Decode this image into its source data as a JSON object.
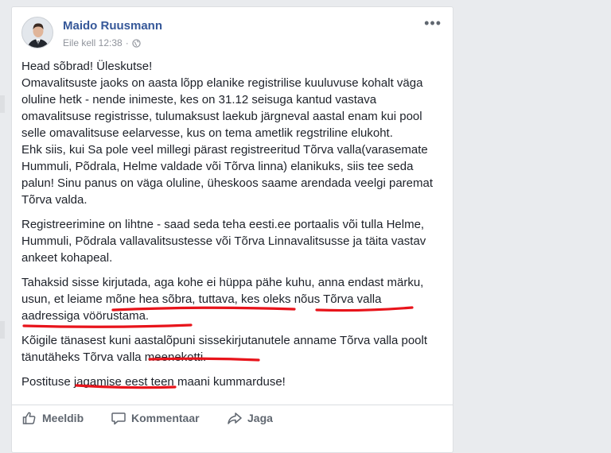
{
  "post": {
    "author": "Maido Ruusmann",
    "timestamp": "Eile kell 12:38",
    "separator": "·",
    "paragraphs": [
      "Head sõbrad! Üleskutse!\nOmavalitsuste jaoks on aasta lõpp elanike registrilise kuuluvuse kohalt väga oluline hetk - nende inimeste, kes on 31.12 seisuga kantud vastava omavalitsuse registrisse, tulumaksust laekub järgneval aastal enam kui pool selle omavalitsuse eelarvesse, kus on tema ametlik regstriline elukoht.\nEhk siis, kui Sa pole veel millegi pärast registreeritud Tõrva valla(varasemate Hummuli, Põdrala, Helme valdade või Tõrva linna) elanikuks, siis tee seda palun! Sinu panus on väga oluline, üheskoos saame arendada veelgi paremat Tõrva valda.",
      "Registreerimine on lihtne - saad seda teha eesti.ee portaalis või tulla Helme, Hummuli, Põdrala vallavalitsustesse või Tõrva Linnavalitsusse ja täita vastav ankeet kohapeal.",
      "Tahaksid sisse kirjutada, aga kohe ei hüppa pähe kuhu, anna endast märku, usun, et leiame mõne hea sõbra, tuttava, kes oleks nõus Tõrva valla aadressiga vöörustama.",
      "Kõigile tänasest kuni aastalõpuni sissekirjutanutele anname Tõrva valla poolt tänutäheks Tõrva valla meenekotti.",
      "Postituse jagamise eest teen maani kummarduse!"
    ]
  },
  "actions": {
    "like": "Meeldib",
    "comment": "Kommentaar",
    "share": "Jaga"
  },
  "icons": {
    "more": "more-options-icon",
    "globe": "globe-icon",
    "like": "thumbs-up-icon",
    "comment": "comment-icon",
    "share": "share-arrow-icon"
  },
  "colors": {
    "author_link": "#365899",
    "annotation_underline": "#e8141b"
  }
}
